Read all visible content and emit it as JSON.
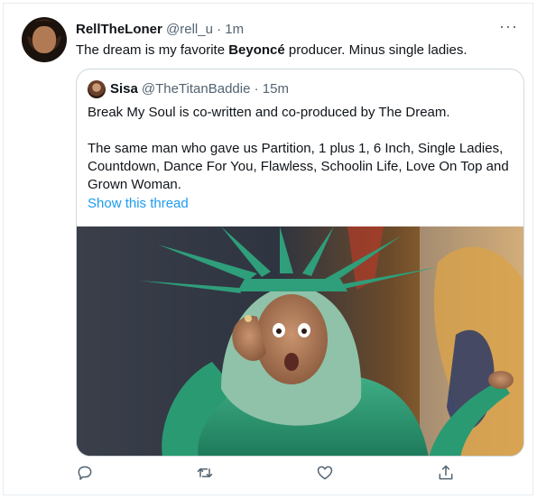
{
  "tweet": {
    "display_name": "RellTheLoner",
    "handle": "@rell_u",
    "separator": "·",
    "time": "1m",
    "text_before": "The dream is my favorite ",
    "text_bold": "Beyoncé",
    "text_after": " producer. Minus single ladies.",
    "more_label": "···"
  },
  "quote": {
    "display_name": "Sisa",
    "handle": "@TheTitanBaddie",
    "separator": "·",
    "time": "15m",
    "paragraph1": "Break My Soul is co-written and co-produced by The Dream.",
    "paragraph2": "The same man who gave us Partition, 1 plus 1, 6 Inch, Single Ladies, Countdown, Dance For You, Flawless, Schoolin Life, Love On Top and Grown Woman.",
    "show_thread": "Show this thread"
  },
  "actions": {
    "icons": [
      "reply-icon",
      "retweet-icon",
      "like-icon",
      "share-icon"
    ]
  },
  "colors": {
    "link": "#1d9bf0",
    "muted": "#536471",
    "border": "#cfd9de"
  }
}
